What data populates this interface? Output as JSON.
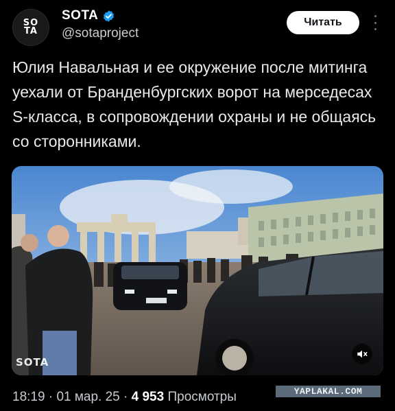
{
  "author": {
    "avatar_text_top": "SO",
    "avatar_text_bottom": "TA",
    "display_name": "SOTA",
    "handle": "@sotaproject"
  },
  "actions": {
    "follow_label": "Читать"
  },
  "tweet": {
    "text": "Юлия Навальная и ее окружение после митинга уехали от Бранденбургских ворот на мерседесах S-класса, в сопровождении охраны и не общаясь со сторонниками."
  },
  "media": {
    "watermark": "SOTA",
    "mute_icon": "speaker-muted-icon"
  },
  "meta": {
    "time": "18:19",
    "date": "01 мар. 25",
    "views_count": "4 953",
    "views_label": "Просмотры"
  },
  "site_badge": "YAPLAKAL.COM",
  "colors": {
    "background": "#000000",
    "verified": "#1d9bf0",
    "logo_accent": "#e34a2f"
  }
}
